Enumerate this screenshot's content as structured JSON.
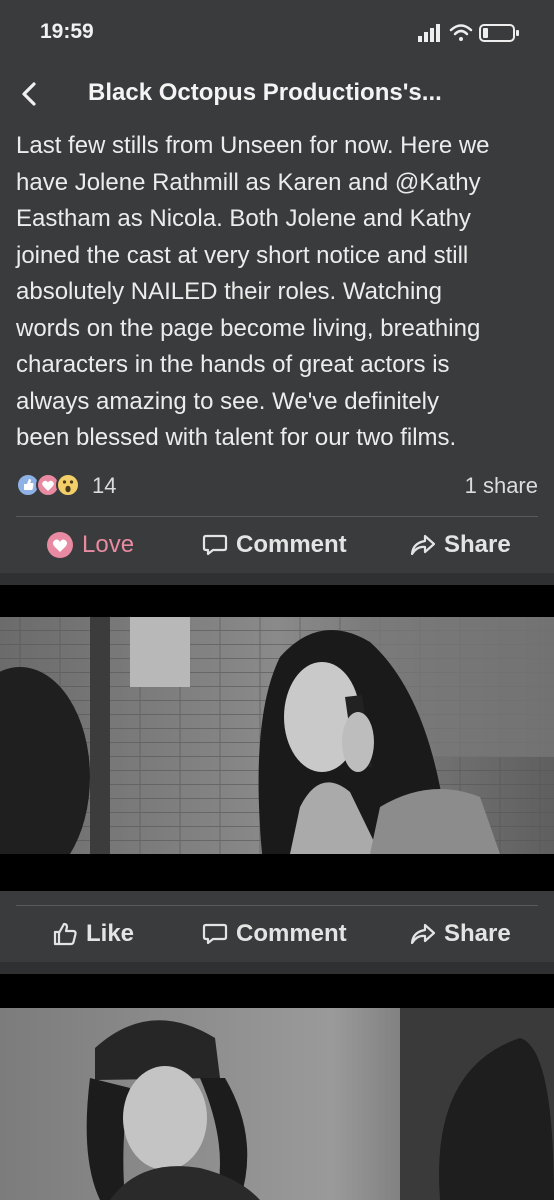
{
  "status_bar": {
    "time": "19:59"
  },
  "nav": {
    "title": "Black Octopus Productions's..."
  },
  "post": {
    "text_lines": [
      "Last few stills from Unseen for now. Here we",
      "have Jolene Rathmill as Karen and @Kathy",
      "Eastham as Nicola. Both Jolene and Kathy",
      "joined the cast at very short notice and still",
      "absolutely NAILED their roles. Watching",
      "words on the page become living, breathing",
      "characters in the hands of great actors is",
      "always amazing to see. We've definitely",
      "been blessed with talent for our two films."
    ],
    "reaction_count": "14",
    "share_count": "1 share",
    "reaction_icons": [
      "like-icon",
      "love-icon",
      "wow-icon"
    ]
  },
  "post_actions": {
    "love_label": "Love",
    "comment_label": "Comment",
    "share_label": "Share"
  },
  "photo1_actions": {
    "like_label": "Like",
    "comment_label": "Comment",
    "share_label": "Share"
  },
  "colors": {
    "background": "#3a3b3c",
    "love_accent": "#e88aa2",
    "text": "#ececec"
  }
}
